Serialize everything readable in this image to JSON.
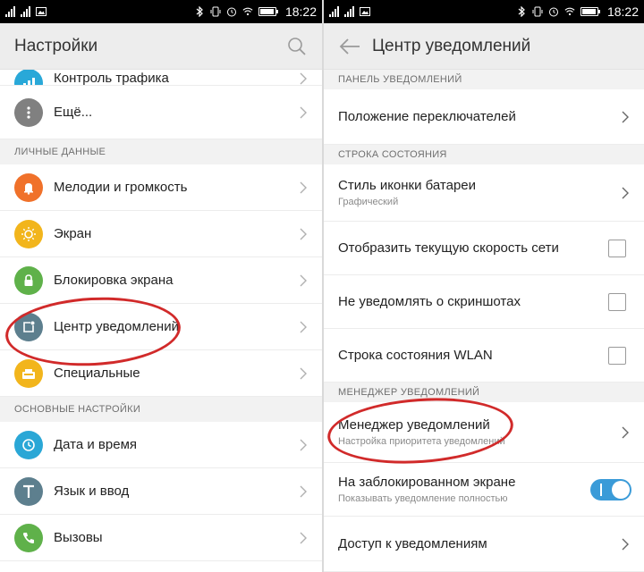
{
  "status_bar": {
    "time": "18:22"
  },
  "left_screen": {
    "title": "Настройки",
    "search_icon": "search-icon",
    "partial_top_item": {
      "label": "Контроль трафика",
      "icon": "traffic-icon",
      "color": "#29a8d8"
    },
    "items_top": [
      {
        "label": "Ещё...",
        "icon": "more-icon",
        "color": "#808080"
      }
    ],
    "sections": [
      {
        "header": "ЛИЧНЫЕ ДАННЫЕ",
        "items": [
          {
            "label": "Мелодии и громкость",
            "icon": "bell-icon",
            "color": "#f0712a"
          },
          {
            "label": "Экран",
            "icon": "brightness-icon",
            "color": "#f2b51c"
          },
          {
            "label": "Блокировка экрана",
            "icon": "lock-icon",
            "color": "#5fb14a"
          },
          {
            "label": "Центр уведомлений",
            "icon": "notification-icon",
            "color": "#5d7f8e"
          },
          {
            "label": "Специальные",
            "icon": "special-icon",
            "color": "#f2b51c"
          }
        ]
      },
      {
        "header": "ОСНОВНЫЕ НАСТРОЙКИ",
        "items": [
          {
            "label": "Дата и время",
            "icon": "clock-icon",
            "color": "#2aa7d6"
          },
          {
            "label": "Язык и ввод",
            "icon": "language-icon",
            "color": "#5d7f8e"
          },
          {
            "label": "Вызовы",
            "icon": "phone-icon",
            "color": "#5fb14a"
          }
        ]
      }
    ]
  },
  "right_screen": {
    "title": "Центр уведомлений",
    "sections": [
      {
        "header": "ПАНЕЛЬ УВЕДОМЛЕНИЙ",
        "items": [
          {
            "label": "Положение переключателей",
            "control": "chevron"
          }
        ]
      },
      {
        "header": "СТРОКА СОСТОЯНИЯ",
        "items": [
          {
            "label": "Стиль иконки батареи",
            "sub": "Графический",
            "control": "chevron"
          },
          {
            "label": "Отобразить текущую скорость сети",
            "control": "checkbox"
          },
          {
            "label": "Не уведомлять о скриншотах",
            "control": "checkbox"
          },
          {
            "label": "Строка состояния WLAN",
            "control": "checkbox"
          }
        ]
      },
      {
        "header": "МЕНЕДЖЕР УВЕДОМЛЕНИЙ",
        "items": [
          {
            "label": "Менеджер уведомлений",
            "sub": "Настройка приоритета уведомлений",
            "control": "chevron"
          },
          {
            "label": "На заблокированном экране",
            "sub": "Показывать уведомление полностью",
            "control": "toggle",
            "value": true
          },
          {
            "label": "Доступ к уведомлениям",
            "control": "chevron"
          }
        ]
      }
    ]
  },
  "colors": {
    "annotation": "#d12a2a",
    "toggle_on": "#3a9bd8",
    "appbar": "#ededed"
  }
}
